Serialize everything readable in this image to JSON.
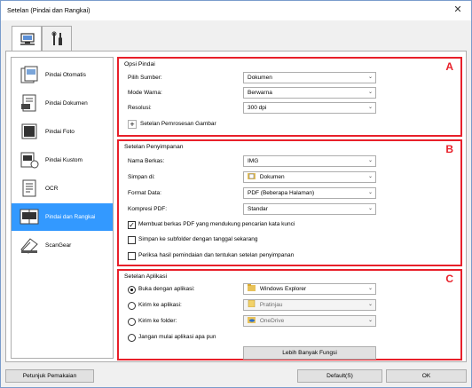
{
  "window": {
    "title": "Setelan (Pindai dan Rangkai)",
    "close_glyph": "✕"
  },
  "tabs": [
    {
      "name": "scan-tab",
      "icon": "scanner-computer-icon"
    },
    {
      "name": "general-settings-tab",
      "icon": "tools-icon"
    }
  ],
  "sidebar": {
    "items": [
      {
        "label": "Pindai Otomatis",
        "icon": "auto-scan-icon",
        "selected": false
      },
      {
        "label": "Pindai Dokumen",
        "icon": "document-scan-icon",
        "selected": false
      },
      {
        "label": "Pindai Foto",
        "icon": "photo-scan-icon",
        "selected": false
      },
      {
        "label": "Pindai Kustom",
        "icon": "custom-scan-icon",
        "selected": false
      },
      {
        "label": "OCR",
        "icon": "ocr-icon",
        "selected": false
      },
      {
        "label": "Pindai dan Rangkai",
        "icon": "stitch-scan-icon",
        "selected": true
      },
      {
        "label": "ScanGear",
        "icon": "scangear-icon",
        "selected": false
      }
    ]
  },
  "scan_options": {
    "title": "Opsi Pindai",
    "letter": "A",
    "source_label": "Pilih Sumber:",
    "source_value": "Dokumen",
    "color_label": "Mode Warna:",
    "color_value": "Berwarna",
    "resolution_label": "Resolusi:",
    "resolution_value": "300 dpi",
    "image_processing_label": "Setelan Pemrosesan Gambar"
  },
  "save_settings": {
    "title": "Setelan Penyimpanan",
    "letter": "B",
    "filename_label": "Nama Berkas:",
    "filename_value": "IMG",
    "save_in_label": "Simpan di:",
    "save_in_value": "Dokumen",
    "format_label": "Format Data:",
    "format_value": "PDF (Beberapa Halaman)",
    "compression_label": "Kompresi PDF:",
    "compression_value": "Standar",
    "check_keyword": {
      "label": "Membuat berkas PDF yang mendukung pencarian kata kunci",
      "checked": true
    },
    "check_subfolder": {
      "label": "Simpan ke subfolder dengan tanggal sekarang",
      "checked": false
    },
    "check_review": {
      "label": "Periksa hasil pemindaian dan tentukan setelan penyimpanan",
      "checked": false
    }
  },
  "app_settings": {
    "title": "Setelan Aplikasi",
    "letter": "C",
    "open_app": {
      "label": "Buka dengan aplikasi:",
      "value": "Windows Explorer",
      "selected": true
    },
    "send_app": {
      "label": "Kirim ke aplikasi:",
      "value": "Pratinjau",
      "selected": false
    },
    "send_folder": {
      "label": "Kirim ke folder:",
      "value": "OneDrive",
      "selected": false
    },
    "no_app": {
      "label": "Jangan mulai aplikasi apa pun",
      "selected": false
    },
    "more_functions_label": "Lebih Banyak Fungsi"
  },
  "footer": {
    "help_label": "Petunjuk Pemakaian",
    "defaults_label": "Default(S)",
    "ok_label": "OK"
  },
  "chevron_glyph": "⌄",
  "accent_color": "#e8202a",
  "selection_color": "#3399ff"
}
